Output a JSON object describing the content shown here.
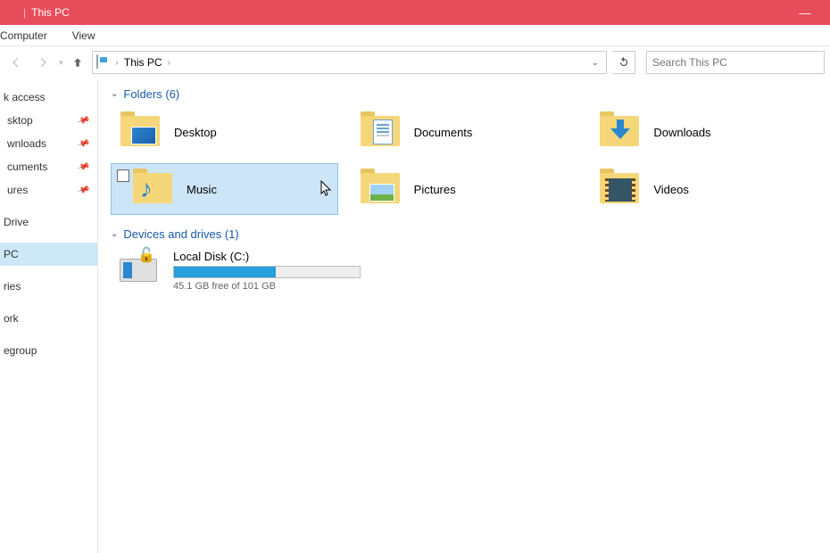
{
  "window": {
    "title": "This PC",
    "minimize": "—"
  },
  "ribbon": {
    "tabs": [
      "Computer",
      "View"
    ]
  },
  "nav": {
    "breadcrumb": "This PC",
    "search_placeholder": "Search This PC"
  },
  "sidebar": {
    "items": [
      {
        "label": "k access",
        "pinned": false
      },
      {
        "label": "sktop",
        "pinned": true
      },
      {
        "label": "wnloads",
        "pinned": true
      },
      {
        "label": "cuments",
        "pinned": true
      },
      {
        "label": "ures",
        "pinned": true
      }
    ],
    "items2": [
      {
        "label": "Drive"
      }
    ],
    "items3": [
      {
        "label": "PC",
        "selected": true
      }
    ],
    "items4": [
      {
        "label": "ries"
      }
    ],
    "items5": [
      {
        "label": "ork"
      }
    ],
    "items6": [
      {
        "label": "egroup"
      }
    ]
  },
  "main": {
    "folders_header": "Folders (6)",
    "folders": [
      {
        "label": "Desktop",
        "icon": "desktop"
      },
      {
        "label": "Documents",
        "icon": "documents"
      },
      {
        "label": "Downloads",
        "icon": "downloads"
      },
      {
        "label": "Music",
        "icon": "music",
        "selected": true
      },
      {
        "label": "Pictures",
        "icon": "pictures"
      },
      {
        "label": "Videos",
        "icon": "videos"
      }
    ],
    "drives_header": "Devices and drives (1)",
    "drive": {
      "name": "Local Disk (C:)",
      "free_text": "45.1 GB free of 101 GB",
      "used_percent": 55
    }
  }
}
